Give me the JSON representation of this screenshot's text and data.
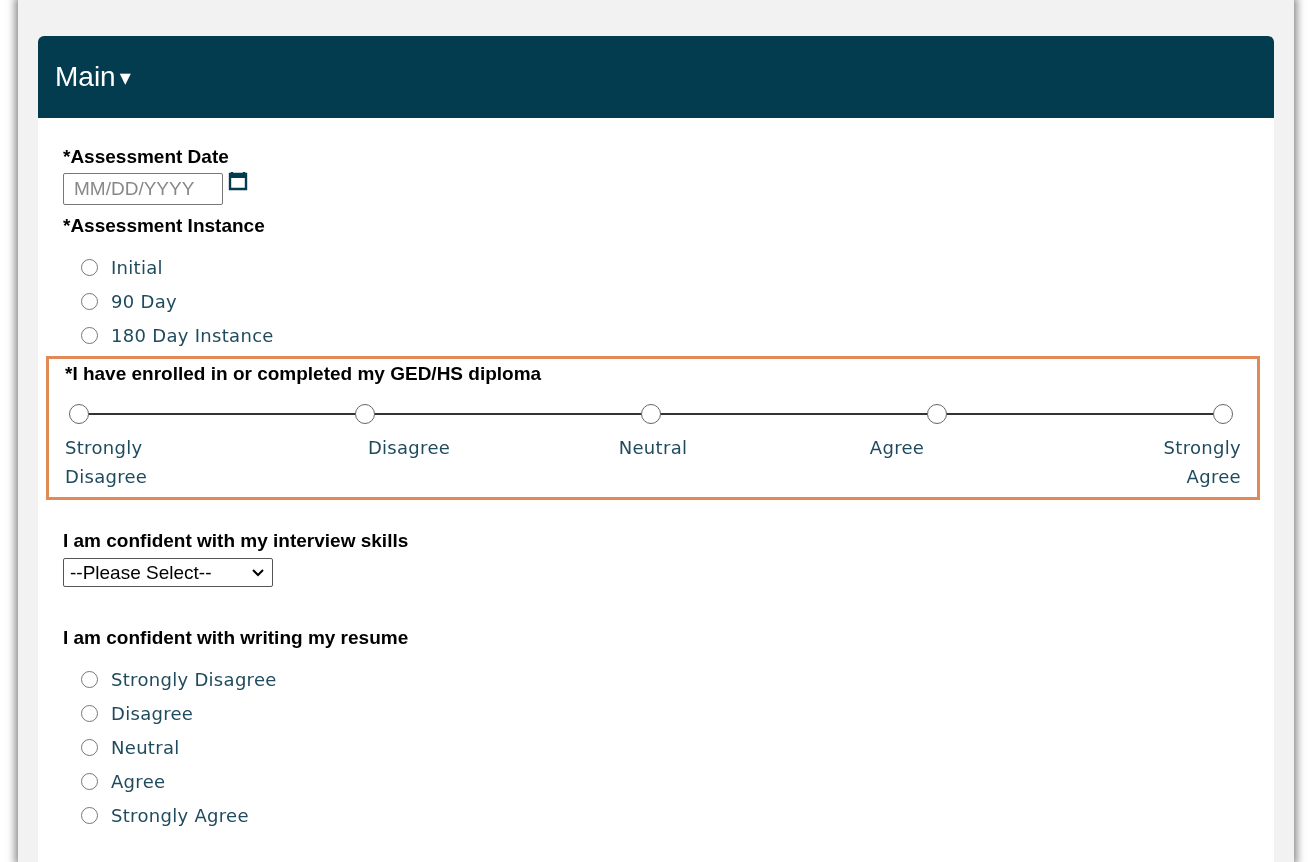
{
  "header": {
    "title": "Main",
    "caret": "▾"
  },
  "fields": [
    {
      "kind": "date",
      "label": "*Assessment Date",
      "placeholder": "MM/DD/YYYY"
    },
    {
      "kind": "radio",
      "label": "*Assessment Instance",
      "options": [
        {
          "label": "Initial",
          "selected": false
        },
        {
          "label": "90 Day",
          "selected": false
        },
        {
          "label": "180 Day Instance",
          "selected": false
        }
      ]
    },
    {
      "kind": "scale",
      "label": "*I have enrolled in or completed my GED/HS diploma",
      "highlighted": true,
      "points": [
        {
          "label": "Strongly Disagree",
          "selected": false
        },
        {
          "label": "Disagree",
          "selected": false
        },
        {
          "label": "Neutral",
          "selected": false
        },
        {
          "label": "Agree",
          "selected": false
        },
        {
          "label": "Strongly Agree",
          "selected": false
        }
      ]
    },
    {
      "kind": "select",
      "label": "I am confident with my interview skills",
      "value": "--Please Select--"
    },
    {
      "kind": "radio",
      "label": "I am confident with writing my resume",
      "options": [
        {
          "label": "Strongly Disagree",
          "selected": false
        },
        {
          "label": "Disagree",
          "selected": false
        },
        {
          "label": "Neutral",
          "selected": false
        },
        {
          "label": "Agree",
          "selected": false
        },
        {
          "label": "Strongly Agree",
          "selected": false
        }
      ]
    }
  ]
}
